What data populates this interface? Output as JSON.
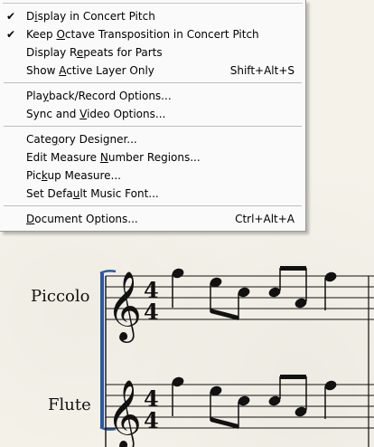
{
  "menu": {
    "items": [
      {
        "label": "Display in Concert Pitch",
        "mnemonic": "i",
        "checked": true,
        "shortcut": ""
      },
      {
        "label": "Keep Octave Transposition in Concert Pitch",
        "mnemonic": "O",
        "checked": true,
        "shortcut": ""
      },
      {
        "label": "Display Repeats for Parts",
        "mnemonic": "e",
        "checked": false,
        "shortcut": ""
      },
      {
        "label": "Show Active Layer Only",
        "mnemonic": "A",
        "checked": false,
        "shortcut": "Shift+Alt+S"
      },
      {
        "label": "Playback/Record Options...",
        "mnemonic": "y",
        "checked": false,
        "shortcut": ""
      },
      {
        "label": "Sync and Video Options...",
        "mnemonic": "V",
        "checked": false,
        "shortcut": ""
      },
      {
        "label": "Category Designer...",
        "mnemonic": "g",
        "checked": false,
        "shortcut": ""
      },
      {
        "label": "Edit Measure Number Regions...",
        "mnemonic": "N",
        "checked": false,
        "shortcut": ""
      },
      {
        "label": "Pickup Measure...",
        "mnemonic": "k",
        "checked": false,
        "shortcut": ""
      },
      {
        "label": "Set Default Music Font...",
        "mnemonic": "u",
        "checked": false,
        "shortcut": ""
      },
      {
        "label": "Document Options...",
        "mnemonic": "D",
        "checked": false,
        "shortcut": "Ctrl+Alt+A"
      }
    ]
  },
  "score": {
    "time_signature": {
      "top": "4",
      "bottom": "4"
    },
    "staves": [
      {
        "instrument": "Piccolo"
      },
      {
        "instrument": "Flute"
      }
    ]
  }
}
